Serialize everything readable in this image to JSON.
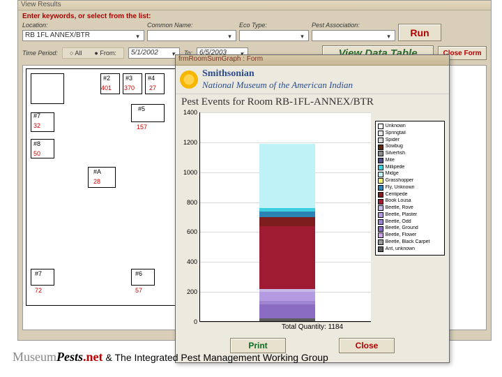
{
  "window": {
    "title": "View Results"
  },
  "filters": {
    "keyword_prompt": "Enter keywords, or select from the list:",
    "location_label": "Location:",
    "location_value": "RB 1FL ANNEX/BTR",
    "common_label": "Common Name:",
    "common_value": "",
    "eco_label": "Eco Type:",
    "eco_value": "",
    "pest_label": "Pest Association:",
    "pest_value": "",
    "run_label": "Run"
  },
  "time": {
    "label": "Time Period:",
    "all": "All",
    "from": "From:",
    "from_value": "5/1/2002",
    "to": "To:",
    "to_value": "6/5/2003",
    "view_table": "View Data Table",
    "close_form": "Close Form"
  },
  "floorplan": {
    "tags": [
      "#2",
      "#3",
      "#4",
      "#7",
      "#5",
      "#8",
      "#A",
      "#7",
      "#6"
    ],
    "reds": [
      "401",
      "370",
      "27",
      "32",
      "157",
      "50",
      "28",
      "72",
      "57"
    ]
  },
  "popup": {
    "title": "frmRoomSumGraph : Form",
    "org1": "Smithsonian",
    "org2": "National Museum of the American Indian",
    "chart_title": "Pest Events for Room RB-1FL-ANNEX/BTR",
    "total": "Total Quantity: 1184",
    "print": "Print",
    "close": "Close"
  },
  "legend": [
    {
      "name": "Unknown",
      "color": "#ffffff"
    },
    {
      "name": "Springtail",
      "color": "#e7e7e7"
    },
    {
      "name": "Spider",
      "color": "#d8d8d8"
    },
    {
      "name": "Sowbug",
      "color": "#5a2a0f"
    },
    {
      "name": "Silverfish",
      "color": "#8a8a8a"
    },
    {
      "name": "Mite",
      "color": "#4f4f8a"
    },
    {
      "name": "Millipede",
      "color": "#3bcfe0"
    },
    {
      "name": "Midge",
      "color": "#bff2f6"
    },
    {
      "name": "Grasshopper",
      "color": "#f4f07a"
    },
    {
      "name": "Fly, Unknown",
      "color": "#2a83b3"
    },
    {
      "name": "Centipede",
      "color": "#7d1d1d"
    },
    {
      "name": "Book Lousa",
      "color": "#9e1b32"
    },
    {
      "name": "Beetle, Rove",
      "color": "#c7b9e6"
    },
    {
      "name": "Beetle, Plaster",
      "color": "#b49ae0"
    },
    {
      "name": "Beetle, Odd",
      "color": "#9f84d1"
    },
    {
      "name": "Beetle, Ground",
      "color": "#8a6dc2"
    },
    {
      "name": "Beetle, Flower",
      "color": "#cfa3e5"
    },
    {
      "name": "Beetle, Black Carpet",
      "color": "#9a9a9a"
    },
    {
      "name": "Ant, unknown",
      "color": "#5d5d5d"
    }
  ],
  "chart_data": {
    "type": "stacked_bar",
    "title": "Pest Events for Room RB-1FL-ANNEX/BTR",
    "xlabel": "",
    "ylabel": "",
    "ylim": [
      0,
      1400
    ],
    "yticks": [
      0,
      200,
      400,
      600,
      800,
      1000,
      1200,
      1400
    ],
    "categories": [
      ""
    ],
    "total": 1184,
    "series": [
      {
        "name": "Midge",
        "value": 430,
        "color": "#bff2f6"
      },
      {
        "name": "Millipede",
        "value": 20,
        "color": "#3bcfe0"
      },
      {
        "name": "Fly, Unknown",
        "value": 40,
        "color": "#2a83b3"
      },
      {
        "name": "Centipede",
        "value": 60,
        "color": "#7d1d1d"
      },
      {
        "name": "Book Lousa",
        "value": 420,
        "color": "#9e1b32"
      },
      {
        "name": "Beetle, Rove",
        "value": 20,
        "color": "#c7b9e6"
      },
      {
        "name": "Beetle, Plaster",
        "value": 60,
        "color": "#b49ae0"
      },
      {
        "name": "Beetle, Odd",
        "value": 24,
        "color": "#9f84d1"
      },
      {
        "name": "Beetle, Ground",
        "value": 90,
        "color": "#8a6dc2"
      },
      {
        "name": "Ant, unknown",
        "value": 20,
        "color": "#5d5d5d"
      }
    ]
  },
  "footer": {
    "brand_a": "Museum",
    "brand_b": "Pests",
    "brand_c": ".net",
    "tail": "& The Integrated Pest Management Working Group"
  }
}
